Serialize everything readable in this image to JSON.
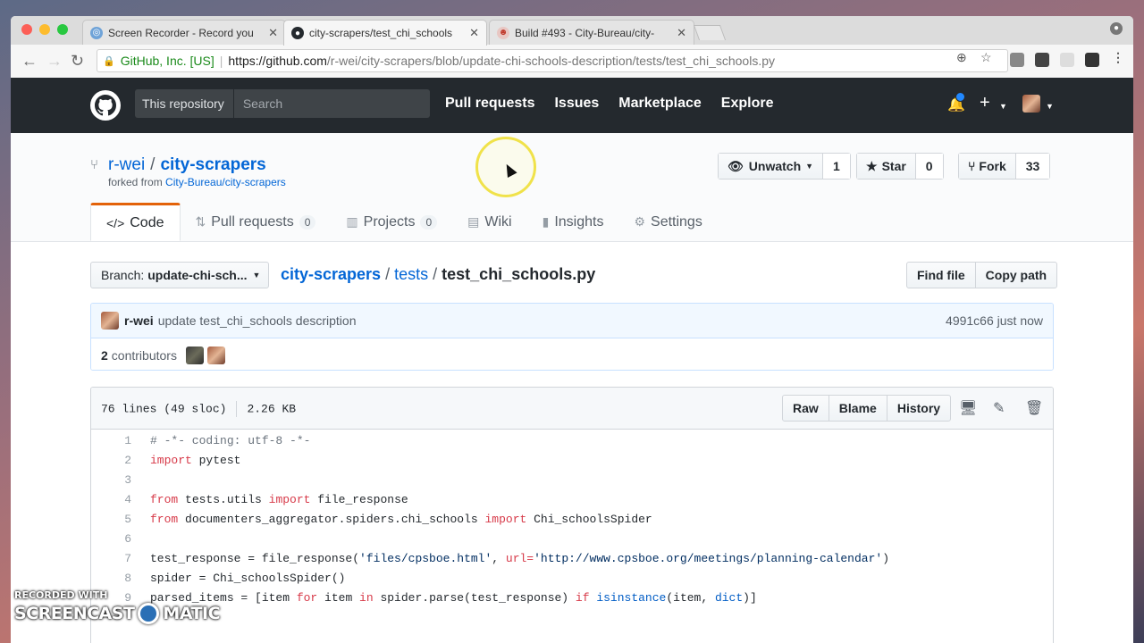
{
  "browser": {
    "tabs": [
      {
        "title": "Screen Recorder - Record you",
        "icon": "screen-recorder-icon"
      },
      {
        "title": "city-scrapers/test_chi_schools",
        "icon": "github-icon",
        "active": true
      },
      {
        "title": "Build #493 - City-Bureau/city-",
        "icon": "travis-icon"
      }
    ],
    "url_ev": "GitHub, Inc. [US]",
    "url_host": "https://github.com",
    "url_path": "/r-wei/city-scrapers/blob/update-chi-schools-description/tests/test_chi_schools.py"
  },
  "gh_header": {
    "scope_label": "This repository",
    "search_placeholder": "Search",
    "nav": [
      "Pull requests",
      "Issues",
      "Marketplace",
      "Explore"
    ]
  },
  "repo": {
    "owner": "r-wei",
    "name": "city-scrapers",
    "forked_from_prefix": "forked from",
    "forked_from": "City-Bureau/city-scrapers",
    "unwatch_label": "Unwatch",
    "watch_count": "1",
    "star_label": "Star",
    "star_count": "0",
    "fork_label": "Fork",
    "fork_count": "33",
    "tabs": {
      "code": "Code",
      "pulls": "Pull requests",
      "pulls_count": "0",
      "projects": "Projects",
      "projects_count": "0",
      "wiki": "Wiki",
      "insights": "Insights",
      "settings": "Settings"
    }
  },
  "file_nav": {
    "branch_prefix": "Branch:",
    "branch": "update-chi-sch...",
    "path_root": "city-scrapers",
    "path_dir": "tests",
    "path_file": "test_chi_schools.py",
    "find_file": "Find file",
    "copy_path": "Copy path"
  },
  "commit": {
    "author": "r-wei",
    "message": "update test_chi_schools description",
    "sha_time": "4991c66 just now",
    "contributors_count": "2",
    "contributors_label": "contributors"
  },
  "file": {
    "lines_info": "76 lines (49 sloc)",
    "size": "2.26 KB",
    "raw": "Raw",
    "blame": "Blame",
    "history": "History"
  },
  "code": {
    "line_numbers": [
      "1",
      "2",
      "3",
      "4",
      "5",
      "6",
      "7",
      "8",
      "9"
    ],
    "l1_comment": "# -*- coding: utf-8 -*-",
    "l2_import": "import",
    "l2_mod": " pytest",
    "l4_from": "from",
    "l4_mod": " tests.utils ",
    "l4_import": "import",
    "l4_name": " file_response",
    "l5_from": "from",
    "l5_mod": " documenters_aggregator.spiders.chi_schools ",
    "l5_import": "import",
    "l5_name": " Chi_schoolsSpider",
    "l7_a": "test_response = file_response(",
    "l7_s1": "'files/cpsboe.html'",
    "l7_b": ", ",
    "l7_kw": "url",
    "l7_eq": "=",
    "l7_s2": "'http://www.cpsboe.org/meetings/planning-calendar'",
    "l7_c": ")",
    "l8": "spider = Chi_schoolsSpider()",
    "l9_a": "parsed_items = [item ",
    "l9_for": "for",
    "l9_b": " item ",
    "l9_in": "in",
    "l9_c": " spider.parse(test_response) ",
    "l9_if": "if",
    "l9_d": " ",
    "l9_isinstance": "isinstance",
    "l9_e": "(item, ",
    "l9_dict": "dict",
    "l9_f": ")]"
  },
  "watermark": {
    "top": "RECORDED WITH",
    "left": "SCREENCAST",
    "right": "MATIC"
  }
}
